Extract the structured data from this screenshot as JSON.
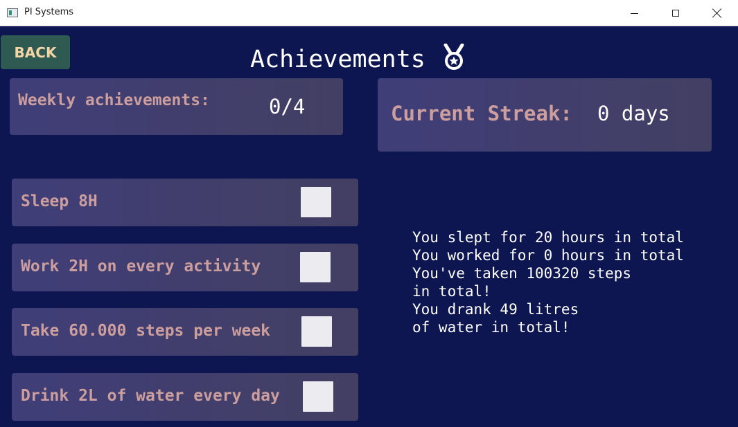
{
  "window": {
    "title": "PI Systems",
    "app_icon": "app-window-icon"
  },
  "nav": {
    "back_label": "BACK"
  },
  "page": {
    "title": "Achievements",
    "title_icon": "medal-icon"
  },
  "weekly": {
    "label": "Weekly achievements:",
    "value": "0/4"
  },
  "streak": {
    "label": "Current Streak:",
    "value": "0 days"
  },
  "achievements": [
    {
      "label": "Sleep 8H",
      "checked": false
    },
    {
      "label": "Work 2H on every activity",
      "checked": false
    },
    {
      "label": "Take 60.000 steps per week",
      "checked": false
    },
    {
      "label": "Drink 2L of water every day",
      "checked": false
    }
  ],
  "stats": {
    "sleep": "You slept for 20 hours in total",
    "work": "You worked for 0 hours in total",
    "steps_1": "You've taken 100320 steps",
    "steps_2": "in total!",
    "water_1": "You drank 49 litres",
    "water_2": "of water in total!"
  },
  "colors": {
    "background": "#0d1650",
    "card": "#3f3e78",
    "accent_label": "#cd9e9e",
    "back_button": "#2e5a52",
    "back_text": "#f2d6a6"
  }
}
